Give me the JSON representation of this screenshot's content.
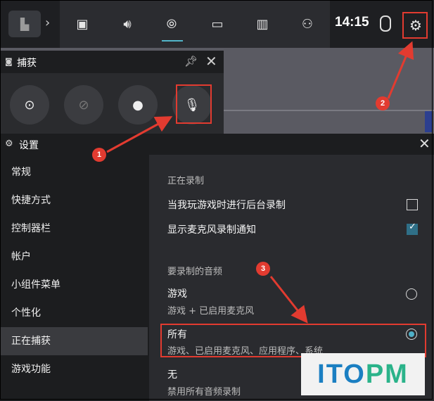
{
  "topbar": {
    "clock": "14:15",
    "icons": [
      "widget-logo-icon",
      "chevron-right-icon",
      "multitask-icon",
      "volume-icon",
      "capture-icon",
      "performance-icon",
      "resources-icon",
      "social-icon",
      "mouse-icon",
      "gear-icon"
    ]
  },
  "capture": {
    "title": "捕获",
    "buttons": [
      "screenshot",
      "record-last-30s",
      "record",
      "microphone-off"
    ]
  },
  "settings": {
    "title": "设置",
    "nav": [
      "常规",
      "快捷方式",
      "控制器栏",
      "帐户",
      "小组件菜单",
      "个性化",
      "正在捕获",
      "游戏功能"
    ],
    "active_nav": "正在捕获",
    "section_recording": "正在录制",
    "opt_background": "当我玩游戏时进行后台录制",
    "opt_background_checked": false,
    "opt_mic_notice": "显示麦克风录制通知",
    "opt_mic_notice_checked": true,
    "section_audio": "要录制的音频",
    "audio_options": [
      {
        "title": "游戏",
        "sub": "游戏 + 已启用麦克风",
        "selected": false
      },
      {
        "title": "所有",
        "sub": "游戏、已启用麦克风、应用程序、系统",
        "selected": true
      },
      {
        "title": "无",
        "sub": "禁用所有音频录制",
        "selected": false
      }
    ]
  },
  "annotations": {
    "badge1": "1",
    "badge2": "2",
    "badge3": "3"
  },
  "watermark": {
    "left": "ITO",
    "right": "PM"
  },
  "colors": {
    "accent": "#4fb0c8",
    "annotation": "#e23b30"
  }
}
